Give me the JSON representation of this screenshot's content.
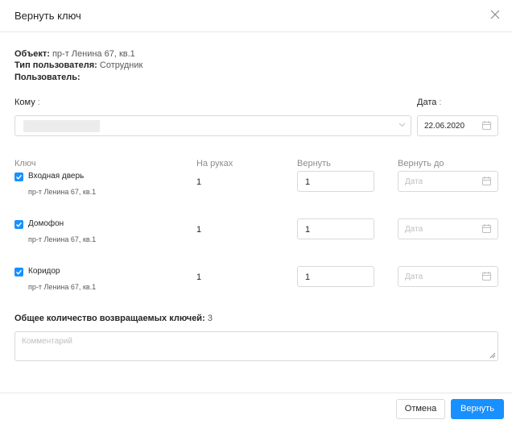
{
  "dialog": {
    "title": "Вернуть ключ",
    "close_icon": "close-icon"
  },
  "info": {
    "object_label": "Объект:",
    "object_value": "пр-т Ленина 67, кв.1",
    "user_type_label": "Тип пользователя:",
    "user_type_value": "Сотрудник",
    "user_label": "Пользователь:"
  },
  "form": {
    "to_label": "Кому",
    "to_value": "",
    "date_label": "Дата",
    "date_value": "22.06.2020"
  },
  "table": {
    "headers": {
      "key": "Ключ",
      "on_hand": "На руках",
      "return": "Вернуть",
      "return_until": "Вернуть до"
    },
    "rows": [
      {
        "checked": true,
        "name": "Входная дверь",
        "address": "пр-т Ленина 67, кв.1",
        "on_hand": "1",
        "return_qty": "1",
        "date_placeholder": "Дата"
      },
      {
        "checked": true,
        "name": "Домофон",
        "address": "пр-т Ленина 67, кв.1",
        "on_hand": "1",
        "return_qty": "1",
        "date_placeholder": "Дата"
      },
      {
        "checked": true,
        "name": "Коридор",
        "address": "пр-т Ленина 67, кв.1",
        "on_hand": "1",
        "return_qty": "1",
        "date_placeholder": "Дата"
      }
    ]
  },
  "total": {
    "label": "Общее количество возвращаемых ключей:",
    "value": "3"
  },
  "comment": {
    "placeholder": "Комментарий"
  },
  "footer": {
    "cancel_label": "Отмена",
    "ok_label": "Вернуть"
  },
  "colors": {
    "primary": "#1890ff",
    "border": "#d9d9d9",
    "placeholder": "#bfbfbf"
  }
}
